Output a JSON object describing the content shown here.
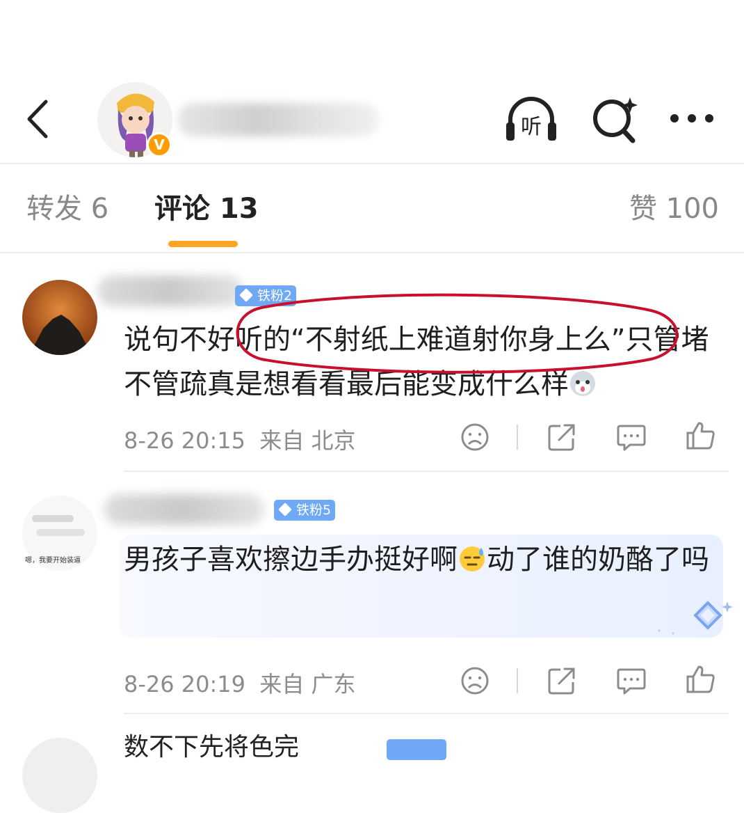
{
  "header": {
    "back_icon": "back-chevron-icon",
    "listen_label": "听",
    "vip_mark": "V"
  },
  "tabs": {
    "repost": "转发 6",
    "comments": "评论 13",
    "likes": "赞 100"
  },
  "comments": [
    {
      "fan_badge": "铁粉2",
      "text_before": "说句不好听的",
      "quote": "“不射纸上难道射你身上么”",
      "text_after": "只管堵不管疏真是想看看最后能变成什么样",
      "time": "8-26 20:15",
      "location": "来自 北京",
      "emoji_icon": "husky-emoji-icon"
    },
    {
      "fan_badge": "铁粉5",
      "text_before": "男孩子喜欢擦边手办挺好啊",
      "text_after": "动了谁的奶酪了吗",
      "time": "8-26 20:19",
      "location": "来自 广东",
      "avatar_caption": "嗯，我要开始装逼",
      "emoji_icon": "sweat-emoji-icon"
    }
  ],
  "next_comment_partial": "数不下先将色完",
  "colors": {
    "accent_orange": "#ffa521",
    "fan_badge_blue": "#6fa8f5",
    "annotation_red": "#c8102e",
    "vip_orange": "#ff9c00"
  }
}
